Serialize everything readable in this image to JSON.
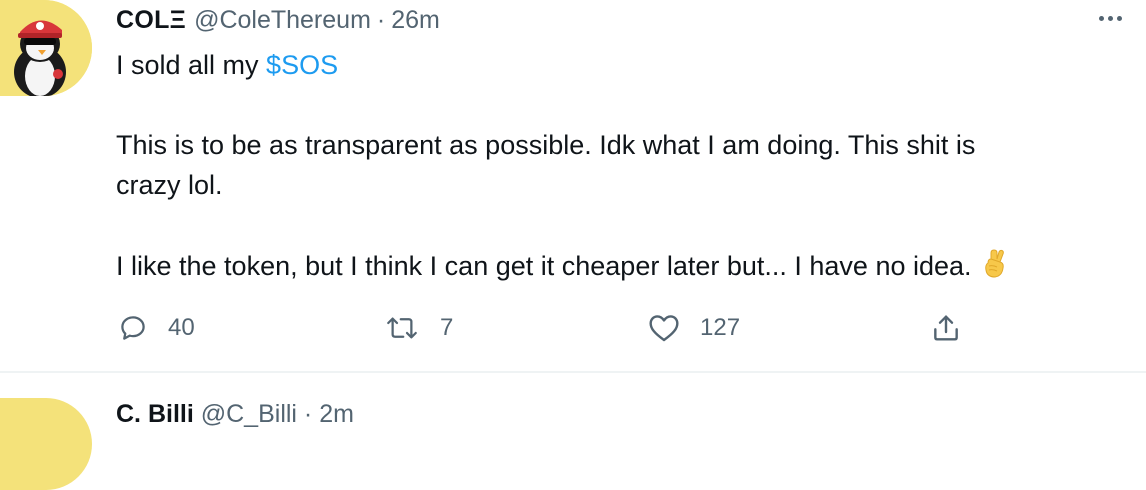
{
  "tweet": {
    "display_name": "COLΞ",
    "handle": "@ColeThereum",
    "separator": "·",
    "time": "26m",
    "lines": {
      "line1_text": "I sold all my ",
      "line1_cashtag": "$SOS",
      "line2": "This is to be as transparent as possible. Idk what I am doing. This shit is",
      "line3": "crazy lol.",
      "line4": "I like the token, but I think I can get it cheaper later but... I have no idea."
    },
    "emoji": "crossed-fingers",
    "actions": {
      "reply_count": "40",
      "retweet_count": "7",
      "like_count": "127"
    }
  },
  "next_tweet": {
    "display_name": "C. Billi",
    "handle": "@C_Billi · 2m"
  },
  "colors": {
    "link": "#1d9bf0",
    "secondary_text": "#536471",
    "primary_text": "#0f1419",
    "avatar_bg": "#f4e27a",
    "divider": "#eff3f4"
  },
  "icons": {
    "more": "more-horizontal-icon",
    "reply": "reply-icon",
    "retweet": "retweet-icon",
    "like": "heart-icon",
    "share": "share-icon"
  }
}
